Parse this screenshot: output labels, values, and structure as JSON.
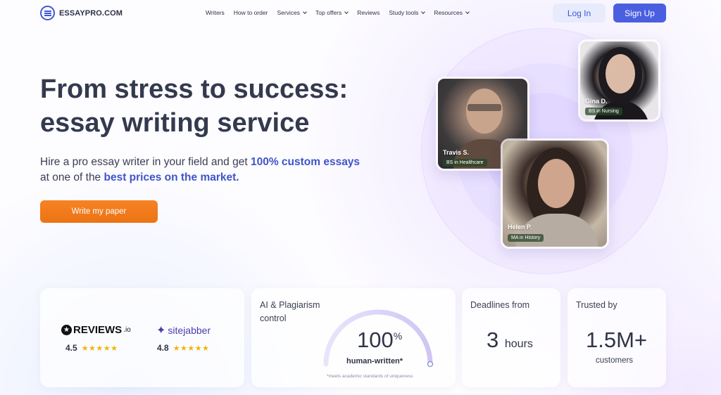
{
  "brand": {
    "name": "ESSAYPRO.COM",
    "accent": "#4a5fe0",
    "cta_color": "#f27d1d"
  },
  "nav": {
    "items": [
      {
        "label": "Writers",
        "dropdown": false
      },
      {
        "label": "How to order",
        "dropdown": false
      },
      {
        "label": "Services",
        "dropdown": true
      },
      {
        "label": "Top offers",
        "dropdown": true
      },
      {
        "label": "Reviews",
        "dropdown": false
      },
      {
        "label": "Study tools",
        "dropdown": true
      },
      {
        "label": "Resources",
        "dropdown": true
      }
    ],
    "login": "Log In",
    "signup": "Sign Up"
  },
  "hero": {
    "title_line1": "From stress to success:",
    "title_line2": "essay writing service",
    "sub_part1": "Hire a pro essay writer in your field and get ",
    "sub_highlight1": "100% custom essays",
    "sub_part2": " at one of the ",
    "sub_highlight2": "best prices on the market.",
    "cta": "Write my paper"
  },
  "writers": [
    {
      "name": "Travis S.",
      "degree": "BS in Healthcare"
    },
    {
      "name": "Gina D.",
      "degree": "BS in Nursing"
    },
    {
      "name": "Helen P.",
      "degree": "MA in History"
    }
  ],
  "reviews": {
    "reviewsio": {
      "name": "REVIEWS",
      "suffix": ".io",
      "rating": "4.5",
      "stars": 4.5
    },
    "sitejabber": {
      "name": "sitejabber",
      "rating": "4.8",
      "stars": 4.8
    }
  },
  "stats": {
    "ai_label": "AI & Plagiarism control",
    "ai_value": "100",
    "ai_unit": "%",
    "ai_sub": "human-written*",
    "ai_note": "*meets academic standards of uniqueness",
    "deadline_label": "Deadlines from",
    "deadline_value": "3",
    "deadline_unit": "hours",
    "trusted_label": "Trusted by",
    "trusted_value": "1.5M+",
    "trusted_sub": "customers"
  }
}
